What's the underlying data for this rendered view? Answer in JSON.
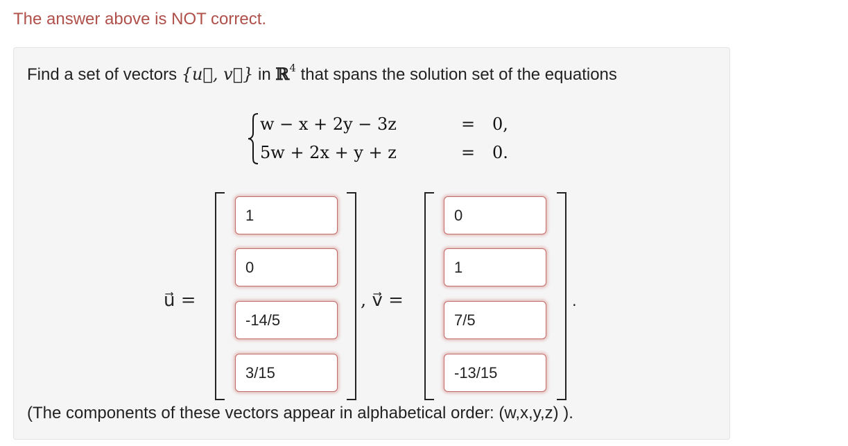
{
  "warning": "The answer above is NOT correct.",
  "question": {
    "prefix": "Find a set of vectors ",
    "set": "{u⃗, v⃗}",
    "in": " in ",
    "space": "ℝ",
    "dim": "4",
    "suffix": " that spans the solution set of the equations"
  },
  "system": {
    "rows": [
      {
        "lhs": "w − x + 2y − 3z",
        "rel": "=",
        "rhs": "0,"
      },
      {
        "lhs": "5w + 2x + y + z",
        "rel": "=",
        "rhs": "0."
      }
    ]
  },
  "labels": {
    "u": "u⃗ =",
    "v": ", v⃗ =",
    "end": "."
  },
  "vector_u": [
    "1",
    "0",
    "-14/5",
    "3/15"
  ],
  "vector_v": [
    "0",
    "1",
    "7/5",
    "-13/15"
  ],
  "footnote": "(The components of these vectors appear in alphabetical order: (w,x,y,z) ).",
  "colors": {
    "warning": "#b0504b",
    "input_border": "#c46a66",
    "panel_bg": "#f5f5f5"
  }
}
